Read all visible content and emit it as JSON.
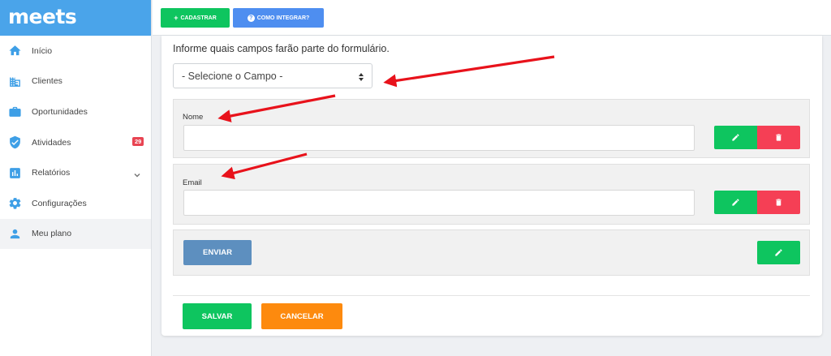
{
  "app": {
    "brand": "meets"
  },
  "sidebar": {
    "items": [
      {
        "label": "Início",
        "icon": "home-icon"
      },
      {
        "label": "Clientes",
        "icon": "building-icon"
      },
      {
        "label": "Oportunidades",
        "icon": "briefcase-icon"
      },
      {
        "label": "Atividades",
        "icon": "shield-check-icon",
        "badge": "29"
      },
      {
        "label": "Relatórios",
        "icon": "bar-chart-icon"
      },
      {
        "label": "Configurações",
        "icon": "gear-icon"
      },
      {
        "label": "Meu plano",
        "icon": "user-icon"
      }
    ]
  },
  "toolbar": {
    "cadastrar_label": "CADASTRAR",
    "integrar_label": "COMO INTEGRAR?"
  },
  "form": {
    "instruction": "Informe quais campos farão parte do formulário.",
    "select_placeholder": "- Selecione o Campo -",
    "fields": [
      {
        "label": "Nome",
        "value": ""
      },
      {
        "label": "Email",
        "value": ""
      }
    ],
    "submit_label": "ENVIAR"
  },
  "footer": {
    "save_label": "SALVAR",
    "cancel_label": "CANCELAR"
  },
  "colors": {
    "brand_blue": "#4aa4ea",
    "green": "#0ec55f",
    "red": "#f53f55",
    "orange": "#fd8a0e",
    "blue_button": "#4e8ef0",
    "send_button": "#5d8fbf",
    "annotation_arrow": "#e8121b"
  }
}
